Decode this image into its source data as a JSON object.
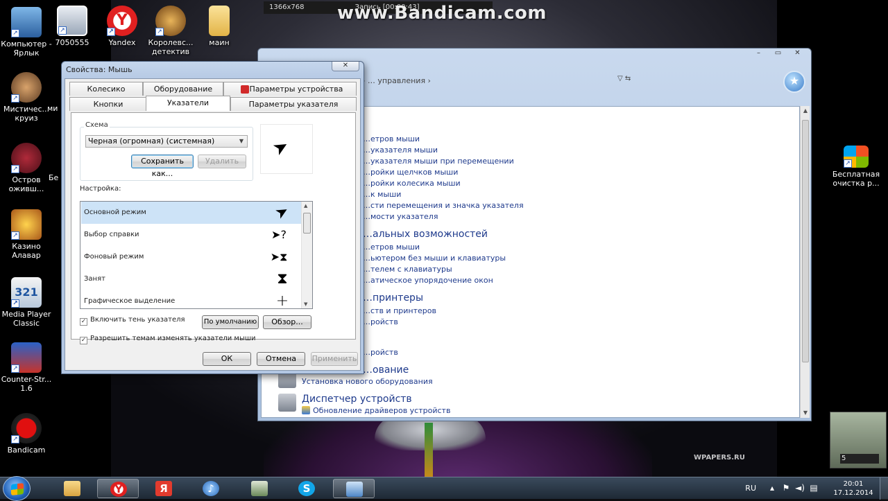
{
  "desktop": {
    "icons_left": [
      {
        "label": "Компьютер - Ярлык",
        "icon": "computer-icon"
      },
      {
        "label": "Мистичес... круиз",
        "icon": "game-icon"
      },
      {
        "label": "Остров оживш...",
        "icon": "game-icon"
      },
      {
        "label": "Казино Алавар",
        "icon": "crown-icon"
      },
      {
        "label": "Media Player Classic",
        "icon": "video-player-icon"
      },
      {
        "label": "Counter-Str... 1.6",
        "icon": "counter-strike-icon"
      },
      {
        "label": "Bandicam",
        "icon": "bandicam-icon"
      }
    ],
    "partial_labels": [
      "М",
      "ми",
      "Бе"
    ],
    "icons_top": [
      {
        "label": "7050555",
        "icon": "image-icon"
      },
      {
        "label": "Yandex",
        "icon": "yandex-icon"
      },
      {
        "label": "Королевс... детектив",
        "icon": "game-icon"
      },
      {
        "label": "маин",
        "icon": "folder-icon"
      }
    ],
    "icons_right": [
      {
        "label": "Бесплатная очистка р...",
        "icon": "cleaner-icon"
      }
    ],
    "widget_label": "5",
    "wallpaper_watermark": "WPAPERS.RU"
  },
  "bandicam": {
    "resolution": "1366x768",
    "record_label": "Запись [00:00:43]",
    "watermark": "www.Bandicam.com"
  },
  "control_panel": {
    "title_buttons": [
      "–",
      "▭",
      "✕"
    ],
    "address": "› … управления ›",
    "mouse_links": [
      "…етров мыши",
      "…указателя мыши",
      "…указателя мыши при перемещении",
      "…ройки щелчков мыши",
      "…ройки колесика мыши",
      "…к мыши",
      "…сти перемещения и значка указателя",
      "…мости указателя"
    ],
    "access_heading": "…альных возможностей",
    "access_links": [
      "…етров мыши",
      "…ьютером без мыши и клавиатуры",
      "…телем с клавиатуры",
      "…атическое упорядочение окон"
    ],
    "printers_heading": "…принтеры",
    "printers_links": [
      "…ств и принтеров",
      "…ройств"
    ],
    "extra_link": "…ройств",
    "hardware_heading": "…ование",
    "hardware_link": "Установка нового оборудования",
    "device_manager_heading": "Диспетчер устройств",
    "device_manager_link": "Обновление драйверов устройств"
  },
  "dialog": {
    "title": "Свойства: Мышь",
    "close": "✕",
    "tabs_row1": [
      "Колесико",
      "Оборудование",
      "Параметры устройства"
    ],
    "tabs_row2": [
      "Кнопки",
      "Указатели",
      "Параметры указателя"
    ],
    "active_tab": "Указатели",
    "scheme": {
      "group_label": "Схема",
      "selected": "Черная (огромная) (системная)",
      "save_as": "Сохранить как...",
      "delete": "Удалить"
    },
    "customize_label": "Настройка:",
    "cursor_rows": [
      {
        "name": "Основной режим",
        "cursor": "arrow-cursor-icon",
        "glyph": "➤"
      },
      {
        "name": "Выбор справки",
        "cursor": "help-cursor-icon",
        "glyph": "➤?"
      },
      {
        "name": "Фоновый режим",
        "cursor": "busy-background-cursor-icon",
        "glyph": "➤⧗"
      },
      {
        "name": "Занят",
        "cursor": "hourglass-cursor-icon",
        "glyph": "⧗"
      },
      {
        "name": "Графическое выделение",
        "cursor": "crosshair-cursor-icon",
        "glyph": "+"
      }
    ],
    "shadow_checkbox": "Включить тень указателя",
    "themes_checkbox": "Разрешить темам изменять указатели мыши",
    "default_button": "По умолчанию",
    "browse_button": "Обзор...",
    "ok": "ОК",
    "cancel": "Отмена",
    "apply": "Применить"
  },
  "taskbar": {
    "items": [
      "explorer-icon",
      "yandex-icon",
      "yandex-browser-icon",
      "sound-icon",
      "tablet-icon",
      "skype-icon",
      "control-panel-icon"
    ],
    "language": "RU",
    "time": "20:01",
    "date": "17.12.2014"
  }
}
